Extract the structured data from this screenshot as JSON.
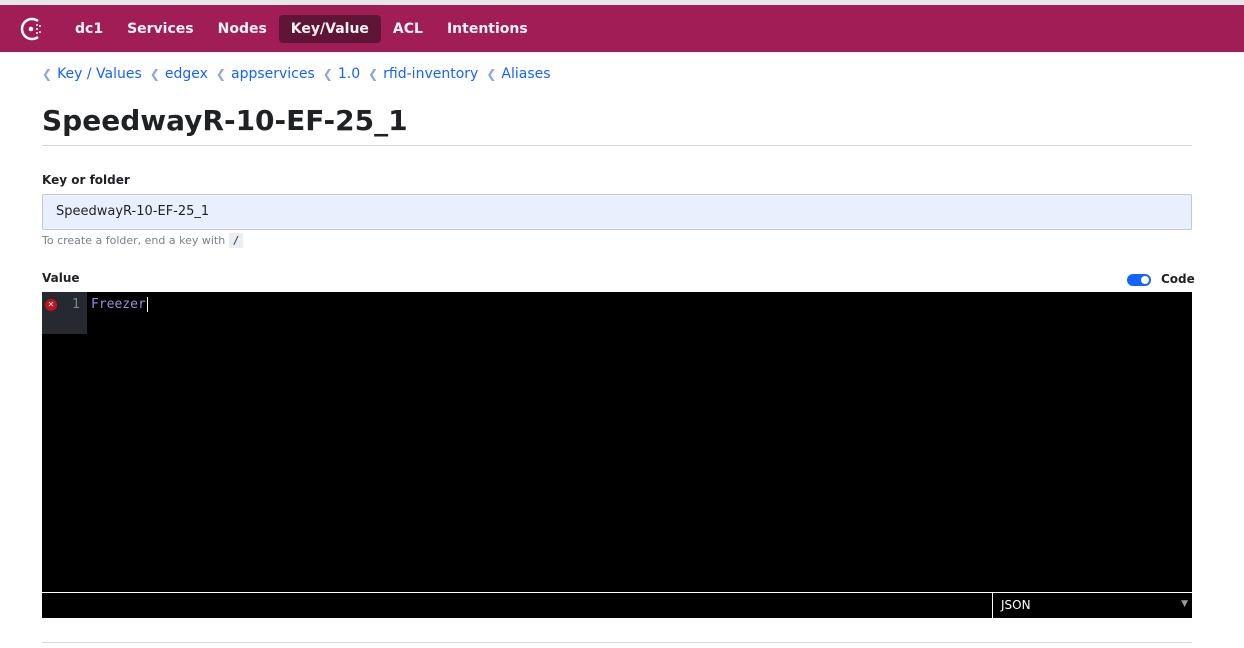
{
  "nav": {
    "items": [
      {
        "label": "dc1"
      },
      {
        "label": "Services"
      },
      {
        "label": "Nodes"
      },
      {
        "label": "Key/Value",
        "active": true
      },
      {
        "label": "ACL"
      },
      {
        "label": "Intentions"
      }
    ]
  },
  "breadcrumbs": [
    "Key / Values",
    "edgex",
    "appservices",
    "1.0",
    "rfid-inventory",
    "Aliases"
  ],
  "page_title": "SpeedwayR-10-EF-25_1",
  "form": {
    "key_label": "Key or folder",
    "key_value": "SpeedwayR-10-EF-25_1",
    "hint": "To create a folder, end a key with",
    "hint_code": "/",
    "value_label": "Value",
    "code_toggle_label": "Code",
    "code_toggle_on": true
  },
  "editor": {
    "line_number": "1",
    "line_text": "Freezer",
    "error_icon": "error-x-icon",
    "mode": "JSON"
  },
  "colors": {
    "brand": "#a11d55",
    "link": "#1563ff"
  }
}
